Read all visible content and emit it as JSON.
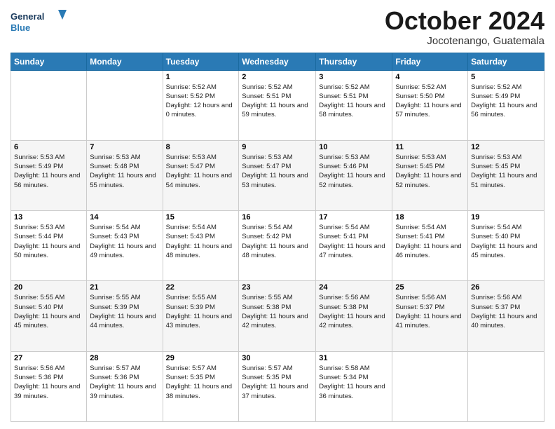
{
  "header": {
    "logo_line1": "General",
    "logo_line2": "Blue",
    "month_year": "October 2024",
    "location": "Jocotenango, Guatemala"
  },
  "days_of_week": [
    "Sunday",
    "Monday",
    "Tuesday",
    "Wednesday",
    "Thursday",
    "Friday",
    "Saturday"
  ],
  "weeks": [
    [
      {
        "day": "",
        "info": ""
      },
      {
        "day": "",
        "info": ""
      },
      {
        "day": "1",
        "info": "Sunrise: 5:52 AM\nSunset: 5:52 PM\nDaylight: 12 hours\nand 0 minutes."
      },
      {
        "day": "2",
        "info": "Sunrise: 5:52 AM\nSunset: 5:51 PM\nDaylight: 11 hours\nand 59 minutes."
      },
      {
        "day": "3",
        "info": "Sunrise: 5:52 AM\nSunset: 5:51 PM\nDaylight: 11 hours\nand 58 minutes."
      },
      {
        "day": "4",
        "info": "Sunrise: 5:52 AM\nSunset: 5:50 PM\nDaylight: 11 hours\nand 57 minutes."
      },
      {
        "day": "5",
        "info": "Sunrise: 5:52 AM\nSunset: 5:49 PM\nDaylight: 11 hours\nand 56 minutes."
      }
    ],
    [
      {
        "day": "6",
        "info": "Sunrise: 5:53 AM\nSunset: 5:49 PM\nDaylight: 11 hours\nand 56 minutes."
      },
      {
        "day": "7",
        "info": "Sunrise: 5:53 AM\nSunset: 5:48 PM\nDaylight: 11 hours\nand 55 minutes."
      },
      {
        "day": "8",
        "info": "Sunrise: 5:53 AM\nSunset: 5:47 PM\nDaylight: 11 hours\nand 54 minutes."
      },
      {
        "day": "9",
        "info": "Sunrise: 5:53 AM\nSunset: 5:47 PM\nDaylight: 11 hours\nand 53 minutes."
      },
      {
        "day": "10",
        "info": "Sunrise: 5:53 AM\nSunset: 5:46 PM\nDaylight: 11 hours\nand 52 minutes."
      },
      {
        "day": "11",
        "info": "Sunrise: 5:53 AM\nSunset: 5:45 PM\nDaylight: 11 hours\nand 52 minutes."
      },
      {
        "day": "12",
        "info": "Sunrise: 5:53 AM\nSunset: 5:45 PM\nDaylight: 11 hours\nand 51 minutes."
      }
    ],
    [
      {
        "day": "13",
        "info": "Sunrise: 5:53 AM\nSunset: 5:44 PM\nDaylight: 11 hours\nand 50 minutes."
      },
      {
        "day": "14",
        "info": "Sunrise: 5:54 AM\nSunset: 5:43 PM\nDaylight: 11 hours\nand 49 minutes."
      },
      {
        "day": "15",
        "info": "Sunrise: 5:54 AM\nSunset: 5:43 PM\nDaylight: 11 hours\nand 48 minutes."
      },
      {
        "day": "16",
        "info": "Sunrise: 5:54 AM\nSunset: 5:42 PM\nDaylight: 11 hours\nand 48 minutes."
      },
      {
        "day": "17",
        "info": "Sunrise: 5:54 AM\nSunset: 5:41 PM\nDaylight: 11 hours\nand 47 minutes."
      },
      {
        "day": "18",
        "info": "Sunrise: 5:54 AM\nSunset: 5:41 PM\nDaylight: 11 hours\nand 46 minutes."
      },
      {
        "day": "19",
        "info": "Sunrise: 5:54 AM\nSunset: 5:40 PM\nDaylight: 11 hours\nand 45 minutes."
      }
    ],
    [
      {
        "day": "20",
        "info": "Sunrise: 5:55 AM\nSunset: 5:40 PM\nDaylight: 11 hours\nand 45 minutes."
      },
      {
        "day": "21",
        "info": "Sunrise: 5:55 AM\nSunset: 5:39 PM\nDaylight: 11 hours\nand 44 minutes."
      },
      {
        "day": "22",
        "info": "Sunrise: 5:55 AM\nSunset: 5:39 PM\nDaylight: 11 hours\nand 43 minutes."
      },
      {
        "day": "23",
        "info": "Sunrise: 5:55 AM\nSunset: 5:38 PM\nDaylight: 11 hours\nand 42 minutes."
      },
      {
        "day": "24",
        "info": "Sunrise: 5:56 AM\nSunset: 5:38 PM\nDaylight: 11 hours\nand 42 minutes."
      },
      {
        "day": "25",
        "info": "Sunrise: 5:56 AM\nSunset: 5:37 PM\nDaylight: 11 hours\nand 41 minutes."
      },
      {
        "day": "26",
        "info": "Sunrise: 5:56 AM\nSunset: 5:37 PM\nDaylight: 11 hours\nand 40 minutes."
      }
    ],
    [
      {
        "day": "27",
        "info": "Sunrise: 5:56 AM\nSunset: 5:36 PM\nDaylight: 11 hours\nand 39 minutes."
      },
      {
        "day": "28",
        "info": "Sunrise: 5:57 AM\nSunset: 5:36 PM\nDaylight: 11 hours\nand 39 minutes."
      },
      {
        "day": "29",
        "info": "Sunrise: 5:57 AM\nSunset: 5:35 PM\nDaylight: 11 hours\nand 38 minutes."
      },
      {
        "day": "30",
        "info": "Sunrise: 5:57 AM\nSunset: 5:35 PM\nDaylight: 11 hours\nand 37 minutes."
      },
      {
        "day": "31",
        "info": "Sunrise: 5:58 AM\nSunset: 5:34 PM\nDaylight: 11 hours\nand 36 minutes."
      },
      {
        "day": "",
        "info": ""
      },
      {
        "day": "",
        "info": ""
      }
    ]
  ]
}
